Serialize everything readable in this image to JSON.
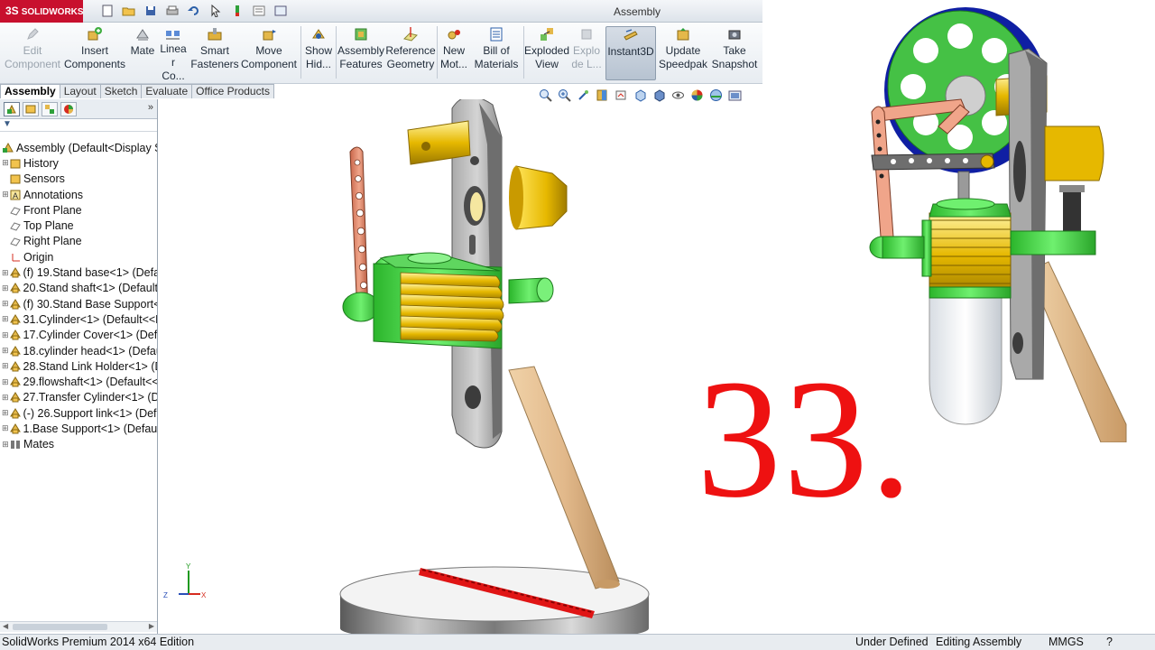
{
  "app": {
    "logo_text": "SOLIDWORKS",
    "document_title": "Assembly"
  },
  "quick_access": [
    "new-icon",
    "open-icon",
    "save-icon",
    "print-icon",
    "undo-icon",
    "select-icon",
    "rebuild-icon",
    "file-properties-icon",
    "options-icon"
  ],
  "commands": [
    {
      "label": "Edit\nComponent",
      "icon": "edit-component-icon",
      "disabled": true
    },
    {
      "label": "Insert\nComponents",
      "icon": "insert-components-icon"
    },
    {
      "label": "Mate",
      "icon": "mate-icon"
    },
    {
      "label": "Linea\nr Co...",
      "icon": "linear-pattern-icon"
    },
    {
      "label": "Smart\nFasteners",
      "icon": "smart-fasteners-icon"
    },
    {
      "label": "Move\nComponent",
      "icon": "move-component-icon"
    },
    {
      "label": "Show\nHid...",
      "icon": "show-hidden-icon"
    },
    {
      "label": "Assembly\nFeatures",
      "icon": "assembly-features-icon"
    },
    {
      "label": "Reference\nGeometry",
      "icon": "reference-geometry-icon"
    },
    {
      "label": "New\nMot...",
      "icon": "new-motion-icon"
    },
    {
      "label": "Bill of\nMaterials",
      "icon": "bom-icon"
    },
    {
      "label": "Exploded\nView",
      "icon": "exploded-view-icon"
    },
    {
      "label": "Explo\nde L...",
      "icon": "explode-line-icon",
      "disabled": true
    },
    {
      "label": "Instant3D",
      "icon": "instant3d-icon",
      "active": true
    },
    {
      "label": "Update\nSpeedpak",
      "icon": "speedpak-icon"
    },
    {
      "label": "Take\nSnapshot",
      "icon": "snapshot-icon"
    }
  ],
  "tabs": [
    "Assembly",
    "Layout",
    "Sketch",
    "Evaluate",
    "Office Products"
  ],
  "active_tab": "Assembly",
  "feature_tree": [
    {
      "label": "Assembly  (Default<Display St",
      "icon": "assembly-icon",
      "expander": ""
    },
    {
      "label": "History",
      "icon": "history-icon",
      "expander": "+"
    },
    {
      "label": "Sensors",
      "icon": "sensors-icon",
      "expander": ""
    },
    {
      "label": "Annotations",
      "icon": "annotations-icon",
      "expander": "+"
    },
    {
      "label": "Front Plane",
      "icon": "plane-icon",
      "expander": ""
    },
    {
      "label": "Top Plane",
      "icon": "plane-icon",
      "expander": ""
    },
    {
      "label": "Right Plane",
      "icon": "plane-icon",
      "expander": ""
    },
    {
      "label": "Origin",
      "icon": "origin-icon",
      "expander": ""
    },
    {
      "label": "(f) 19.Stand base<1> (Defau",
      "icon": "part-icon",
      "expander": "+"
    },
    {
      "label": "20.Stand shaft<1> (Default",
      "icon": "part-icon",
      "expander": "+"
    },
    {
      "label": "(f) 30.Stand Base Support<",
      "icon": "part-icon",
      "expander": "+"
    },
    {
      "label": "31.Cylinder<1> (Default<<D",
      "icon": "part-icon",
      "expander": "+"
    },
    {
      "label": "17.Cylinder Cover<1> (Defa",
      "icon": "part-icon",
      "expander": "+"
    },
    {
      "label": "18.cylinder head<1> (Defau",
      "icon": "part-icon",
      "expander": "+"
    },
    {
      "label": "28.Stand Link Holder<1> (D",
      "icon": "part-icon",
      "expander": "+"
    },
    {
      "label": "29.flowshaft<1> (Default<<",
      "icon": "part-icon",
      "expander": "+"
    },
    {
      "label": "27.Transfer Cylinder<1> (De",
      "icon": "part-icon",
      "expander": "+"
    },
    {
      "label": "(-) 26.Support link<1> (Defa",
      "icon": "part-icon",
      "expander": "+"
    },
    {
      "label": "1.Base Support<1> (Default",
      "icon": "part-icon",
      "expander": "+"
    },
    {
      "label": "Mates",
      "icon": "mates-icon",
      "expander": "+"
    }
  ],
  "status_bar": {
    "edition": "SolidWorks Premium 2014 x64 Edition",
    "state": "Under Defined",
    "mode": "Editing Assembly",
    "units": "MMGS",
    "help": "?"
  },
  "overlay": {
    "number": "33."
  },
  "triad": {
    "x": "X",
    "y": "Y",
    "z": "Z"
  },
  "colors": {
    "accent_red": "#ee1111",
    "logo_red": "#c8102e",
    "cylinder_green": "#44d544",
    "fin_gold": "#e6b800",
    "link_copper": "#e58a6a",
    "flywheel_blue": "#1a2fb8",
    "stand_wood": "#e2b98b"
  }
}
